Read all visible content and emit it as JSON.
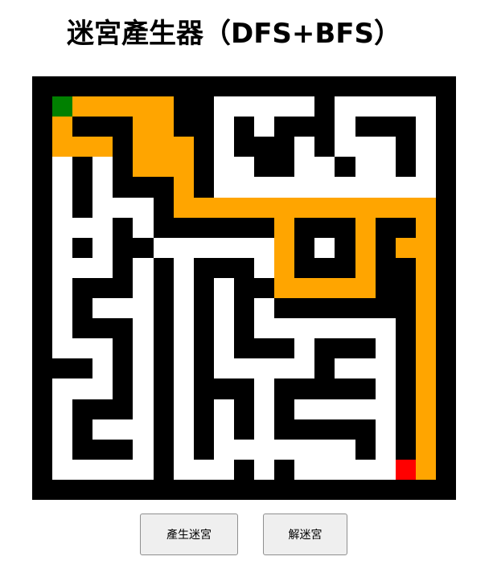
{
  "page": {
    "title": "迷宮產生器（DFS+BFS）"
  },
  "maze": {
    "cols": 10,
    "rows": 10,
    "colors": {
      "wall": "#000000",
      "open": "#ffffff",
      "path": "#ffa500",
      "start": "#008000",
      "end": "#ff0000"
    },
    "grid": [
      "000000000000000000000",
      "0S2222200111110111110",
      "020002200101000100010",
      "022202220100010111010",
      "010102220110011011010",
      "010100020111111111110",
      "010111022222222222220",
      "011101000000200020020",
      "010100111111201020220",
      "011101010001200020020",
      "010001010100222220020",
      "010111010101000000020",
      "010001010101111111020",
      "011101010100010001020",
      "000101010111110111020",
      "011101010001000001020",
      "010001010101011111020",
      "010111010101000001020",
      "010001010111111101020",
      "011111011101011111E20",
      "000000000000000000000"
    ]
  },
  "buttons": {
    "generate_label": "產生迷宮",
    "solve_label": "解迷宮"
  }
}
